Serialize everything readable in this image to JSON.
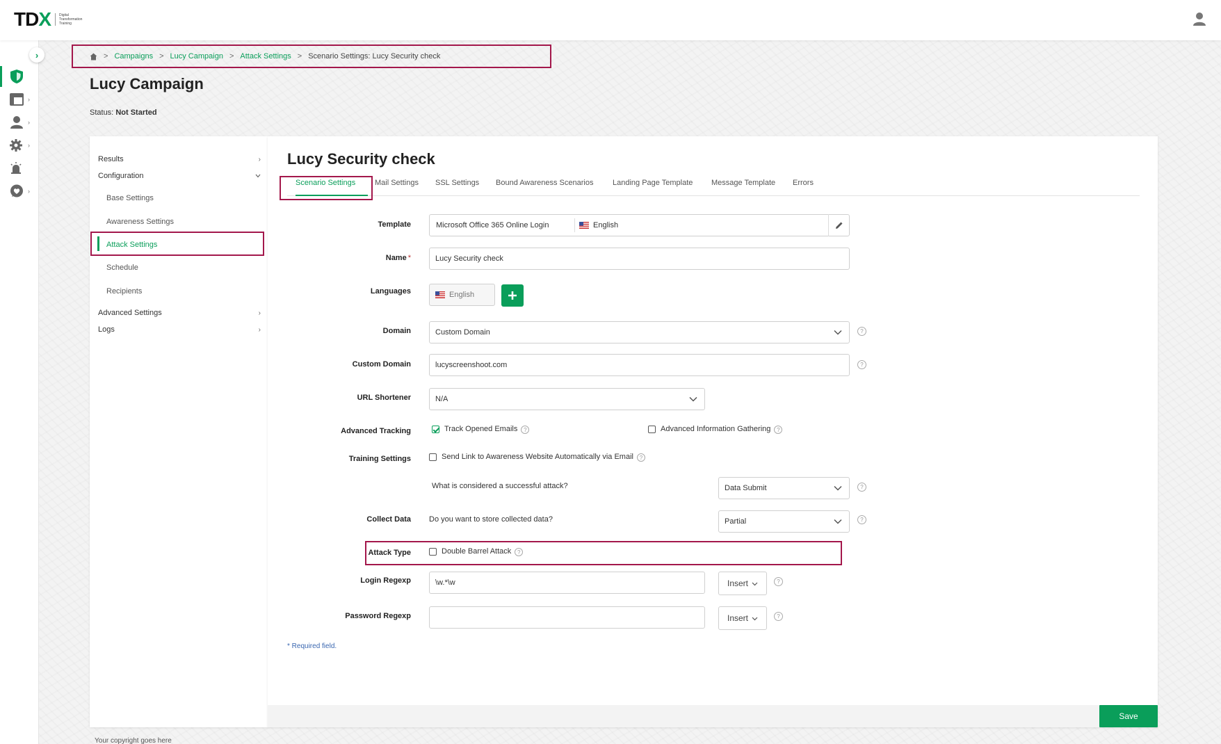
{
  "logo": {
    "mark_a": "TD",
    "mark_b": "X",
    "subtitle": "Digital Transformation Training"
  },
  "breadcrumb": {
    "items": [
      "Campaigns",
      "Lucy Campaign",
      "Attack Settings"
    ],
    "current": "Scenario Settings: Lucy Security check",
    "separator": ">"
  },
  "page": {
    "title": "Lucy Campaign",
    "status_label": "Status:",
    "status_value": "Not Started"
  },
  "nav": {
    "results": "Results",
    "configuration": "Configuration",
    "sub_items": [
      "Base Settings",
      "Awareness Settings",
      "Attack Settings",
      "Schedule",
      "Recipients"
    ],
    "advanced": "Advanced Settings",
    "logs": "Logs"
  },
  "card": {
    "title": "Lucy Security check",
    "tabs": [
      "Scenario Settings",
      "Mail Settings",
      "SSL Settings",
      "Bound Awareness Scenarios",
      "Landing Page Template",
      "Message Template",
      "Errors"
    ]
  },
  "form": {
    "template": {
      "label": "Template",
      "value": "Microsoft Office 365 Online Login",
      "language": "English"
    },
    "name": {
      "label": "Name",
      "required_mark": "*",
      "value": "Lucy Security check"
    },
    "languages": {
      "label": "Languages",
      "value": "English"
    },
    "domain": {
      "label": "Domain",
      "value": "Custom Domain"
    },
    "custom_domain": {
      "label": "Custom Domain",
      "value": "lucyscreenshoot.com"
    },
    "url_shortener": {
      "label": "URL Shortener",
      "value": "N/A"
    },
    "advanced_tracking": {
      "label": "Advanced Tracking",
      "track_opened": "Track Opened Emails",
      "track_opened_checked": true,
      "info_gathering": "Advanced Information Gathering",
      "info_gathering_checked": false
    },
    "training_settings": {
      "label": "Training Settings",
      "send_link": "Send Link to Awareness Website Automatically via Email",
      "checked": false
    },
    "successful_attack": {
      "question": "What is considered a successful attack?",
      "value": "Data Submit"
    },
    "collect_data": {
      "label": "Collect Data",
      "question": "Do you want to store collected data?",
      "value": "Partial"
    },
    "attack_type": {
      "label": "Attack Type",
      "option": "Double Barrel Attack",
      "checked": false
    },
    "login_regexp": {
      "label": "Login Regexp",
      "value": "\\w.*\\w",
      "insert": "Insert"
    },
    "password_regexp": {
      "label": "Password Regexp",
      "value": "",
      "insert": "Insert"
    },
    "help_mark": "?",
    "required_note": "* Required field."
  },
  "save_label": "Save",
  "copyright": "Your copyright goes here",
  "colors": {
    "accent": "#0a9e5a",
    "highlight_border": "#a3174b",
    "link_blue": "#3a67b0"
  }
}
